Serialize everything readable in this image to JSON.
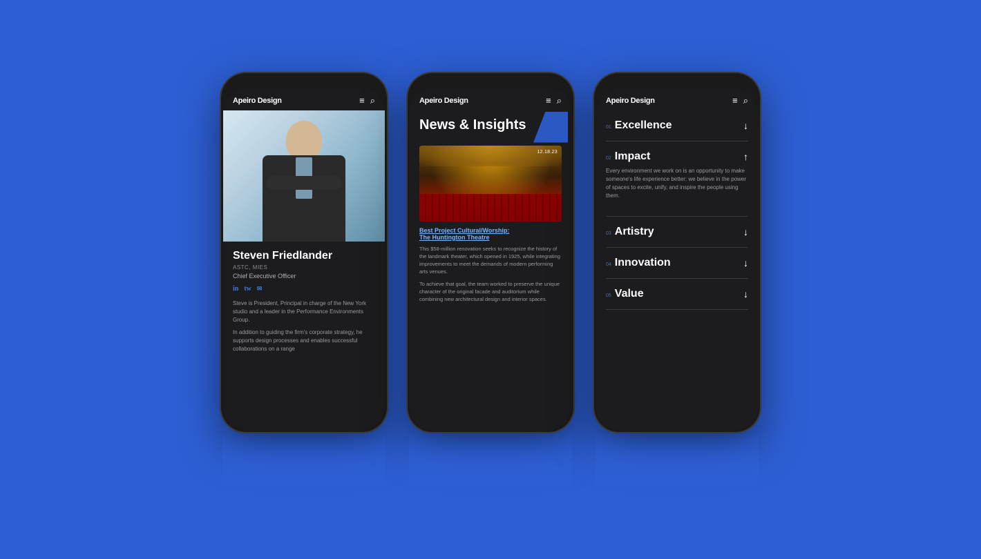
{
  "background": "#2d5fd4",
  "phones": [
    {
      "id": "phone1",
      "type": "profile",
      "nav": {
        "logo": "Apeiro Design",
        "menu_icon": "≡",
        "search_icon": "⌕"
      },
      "profile": {
        "name": "Steven Friedlander",
        "credentials": "ASTC, MIES",
        "title": "Chief Executive Officer",
        "socials": [
          "in",
          "tw",
          "em"
        ],
        "bio_paragraph1": "Steve is President, Principal in charge of the New York studio and a leader in the Performance Environments Group.",
        "bio_paragraph2": "In addition to guiding the firm's corporate strategy, he supports design processes and enables successful collaborations on a range"
      }
    },
    {
      "id": "phone2",
      "type": "news",
      "nav": {
        "logo": "Apeiro Design",
        "menu_icon": "≡",
        "search_icon": "⌕"
      },
      "news": {
        "title": "News & Insights",
        "article": {
          "date": "12.18.23",
          "link_line1": "Best Project Cultural/Worship:",
          "link_line2": "The Huntington Theatre",
          "body1": "This $58-million renovation seeks to recognize the history of the landmark theater, which opened in 1925, while integrating improvements to meet the demands of modern performing arts venues.",
          "body2": "To achieve that goal, the team worked to preserve the unique character of the original facade and auditorium while combining new architectural design and interior spaces."
        }
      }
    },
    {
      "id": "phone3",
      "type": "menu",
      "nav": {
        "logo": "Apeiro Design",
        "menu_icon": "≡",
        "search_icon": "⌕"
      },
      "menu": {
        "items": [
          {
            "number": "01",
            "label": "Excellence",
            "arrow": "↓",
            "active": false
          },
          {
            "number": "02",
            "label": "Impact",
            "arrow": "↑",
            "active": true,
            "description": "Every environment we work on is an opportunity to make someone's life experience better: we believe in the power of spaces to excite, unify, and inspire the people using them."
          },
          {
            "number": "03",
            "label": "Artistry",
            "arrow": "↓",
            "active": false
          },
          {
            "number": "04",
            "label": "Innovation",
            "arrow": "↓",
            "active": false
          },
          {
            "number": "05",
            "label": "Value",
            "arrow": "↓",
            "active": false
          }
        ]
      }
    }
  ],
  "reflection_text": "Steve is President, Principal in charge of the New York studio and a leader in the Performance Environments Group. In addition to guiding the firm's corporate strategy, he supports design processes and enables successful collaborations on a range"
}
